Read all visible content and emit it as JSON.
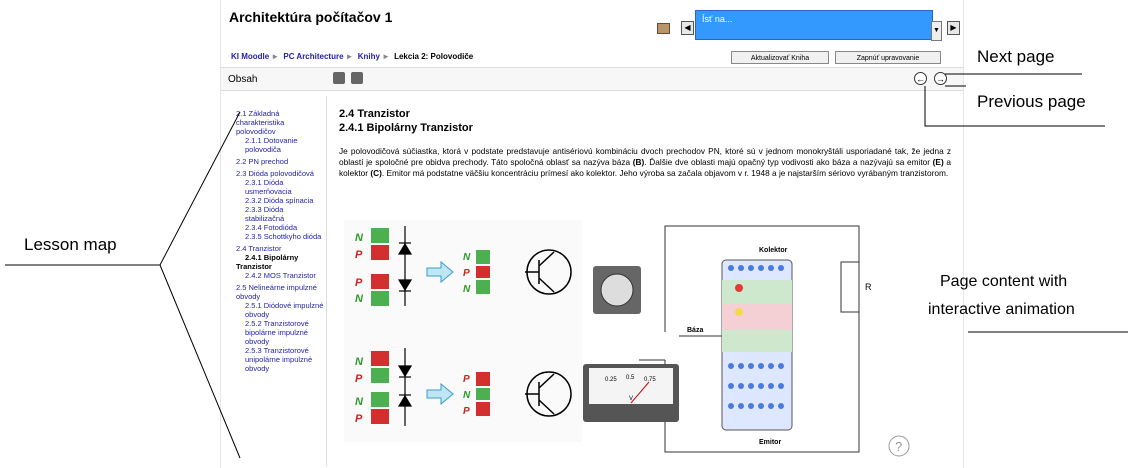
{
  "course_title": "Architektúra počítačov 1",
  "jump_select": {
    "value": "Ísť na..."
  },
  "breadcrumb": [
    {
      "label": "KI Moodle",
      "link": true
    },
    {
      "label": "PC Architecture",
      "link": true
    },
    {
      "label": "Knihy",
      "link": true
    },
    {
      "label": "Lekcia 2: Polovodiče",
      "link": false
    }
  ],
  "buttons": {
    "update": "Aktualizovať Kniha",
    "edit": "Zapnúť upravovanie"
  },
  "toc_label": "Obsah",
  "toc": [
    {
      "label": "2.1 Základná charakteristika polovodičov",
      "level": 1
    },
    {
      "label": "2.1.1 Dotovanie polovodiča",
      "level": 2
    },
    {
      "label": "2.2 PN prechod",
      "level": 1
    },
    {
      "label": "2.3 Dióda polovodičová",
      "level": 1
    },
    {
      "label": "2.3.1 Dióda usmerňovacia",
      "level": 2
    },
    {
      "label": "2.3.2 Dióda spínacia",
      "level": 2
    },
    {
      "label": "2.3.3 Dióda stabilizačná",
      "level": 2
    },
    {
      "label": "2.3.4 Fotodióda",
      "level": 2
    },
    {
      "label": "2.3.5 Schottkyho dióda",
      "level": 2
    },
    {
      "label": "2.4 Tranzistor",
      "level": 1
    },
    {
      "label": "2.4.1 Bipolárny Tranzistor",
      "level": 2,
      "active": true
    },
    {
      "label": "2.4.2 MOS Tranzistor",
      "level": 2
    },
    {
      "label": "2.5 Nelineárne impulzné obvody",
      "level": 1
    },
    {
      "label": "2.5.1 Diódové impulzné obvody",
      "level": 2
    },
    {
      "label": "2.5.2 Tranzistorové bipolárne impulzné obvody",
      "level": 2
    },
    {
      "label": "2.5.3 Tranzistorové unipolárne impulzné obvody",
      "level": 2
    }
  ],
  "content": {
    "heading1": "2.4 Tranzistor",
    "heading2": "2.4.1 Bipolárny Tranzistor",
    "para_1": "Je polovodičová súčiastka, ktorá v podstate predstavuje antisériovú kombináciu dvoch prechodov PN, ktoré sú v jednom monokryštáli usporiadané tak, že jedna z oblastí je spoločné pre obidva prechody. Táto spoločná oblasť sa nazýva báza ",
    "para_b": "(B)",
    "para_2": ". Ďalšie dve oblasti majú opačný typ vodivosti ako báza a nazývajú sa emitor ",
    "para_e": "(E)",
    "para_3": " a kolektor ",
    "para_c": "(C)",
    "para_4": ". Emitor má podstatne väčšiu koncentráciu prímesí ako kolektor. Jeho výroba sa začala objavom v r. 1948 a je najstarším sériovo vyrábaným tranzistorom."
  },
  "animation": {
    "letter_n": "N",
    "letter_p": "P",
    "kolektor": "Kolektor",
    "baza": "Báza",
    "emitor": "Emitor",
    "r": "R",
    "meter_ticks": [
      "0.25",
      "0.5",
      "0.75"
    ],
    "meter_unit": "V",
    "help": "?"
  },
  "callouts": {
    "next": "Next page",
    "previous": "Previous page",
    "lesson_map": "Lesson map",
    "page_content_1": "Page content with",
    "page_content_2": "interactive animation"
  }
}
